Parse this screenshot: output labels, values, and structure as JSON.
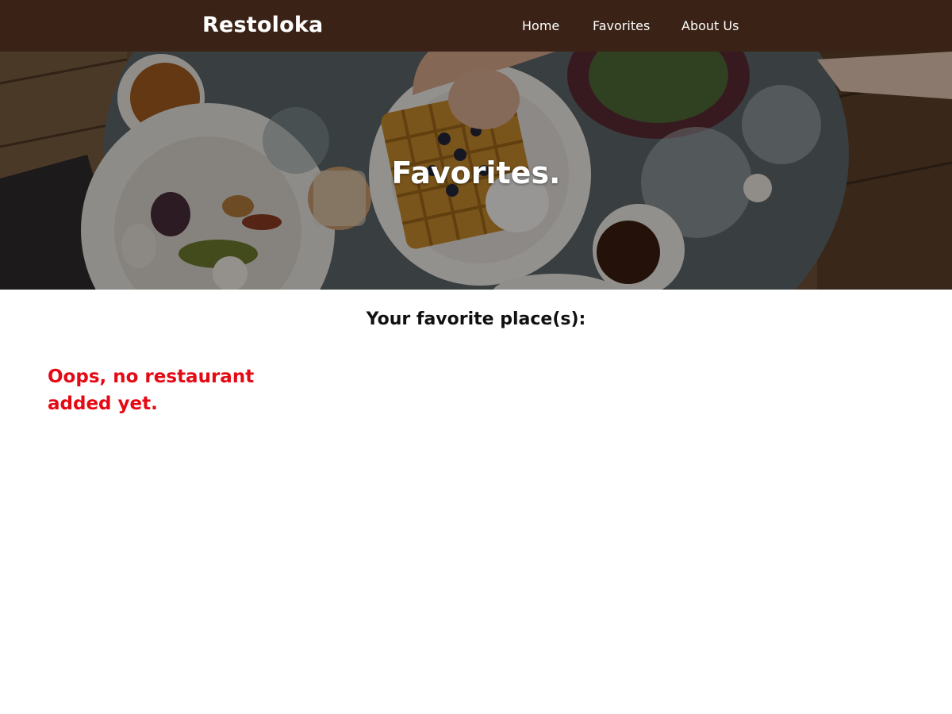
{
  "header": {
    "brand": "Restoloka",
    "nav": [
      {
        "label": "Home"
      },
      {
        "label": "Favorites"
      },
      {
        "label": "About Us"
      }
    ]
  },
  "hero": {
    "title": "Favorites."
  },
  "main": {
    "heading": "Your favorite place(s):",
    "empty_message": "Oops, no restaurant added yet."
  },
  "colors": {
    "navbar_bg": "#3a2316",
    "empty_message": "#e50914"
  }
}
